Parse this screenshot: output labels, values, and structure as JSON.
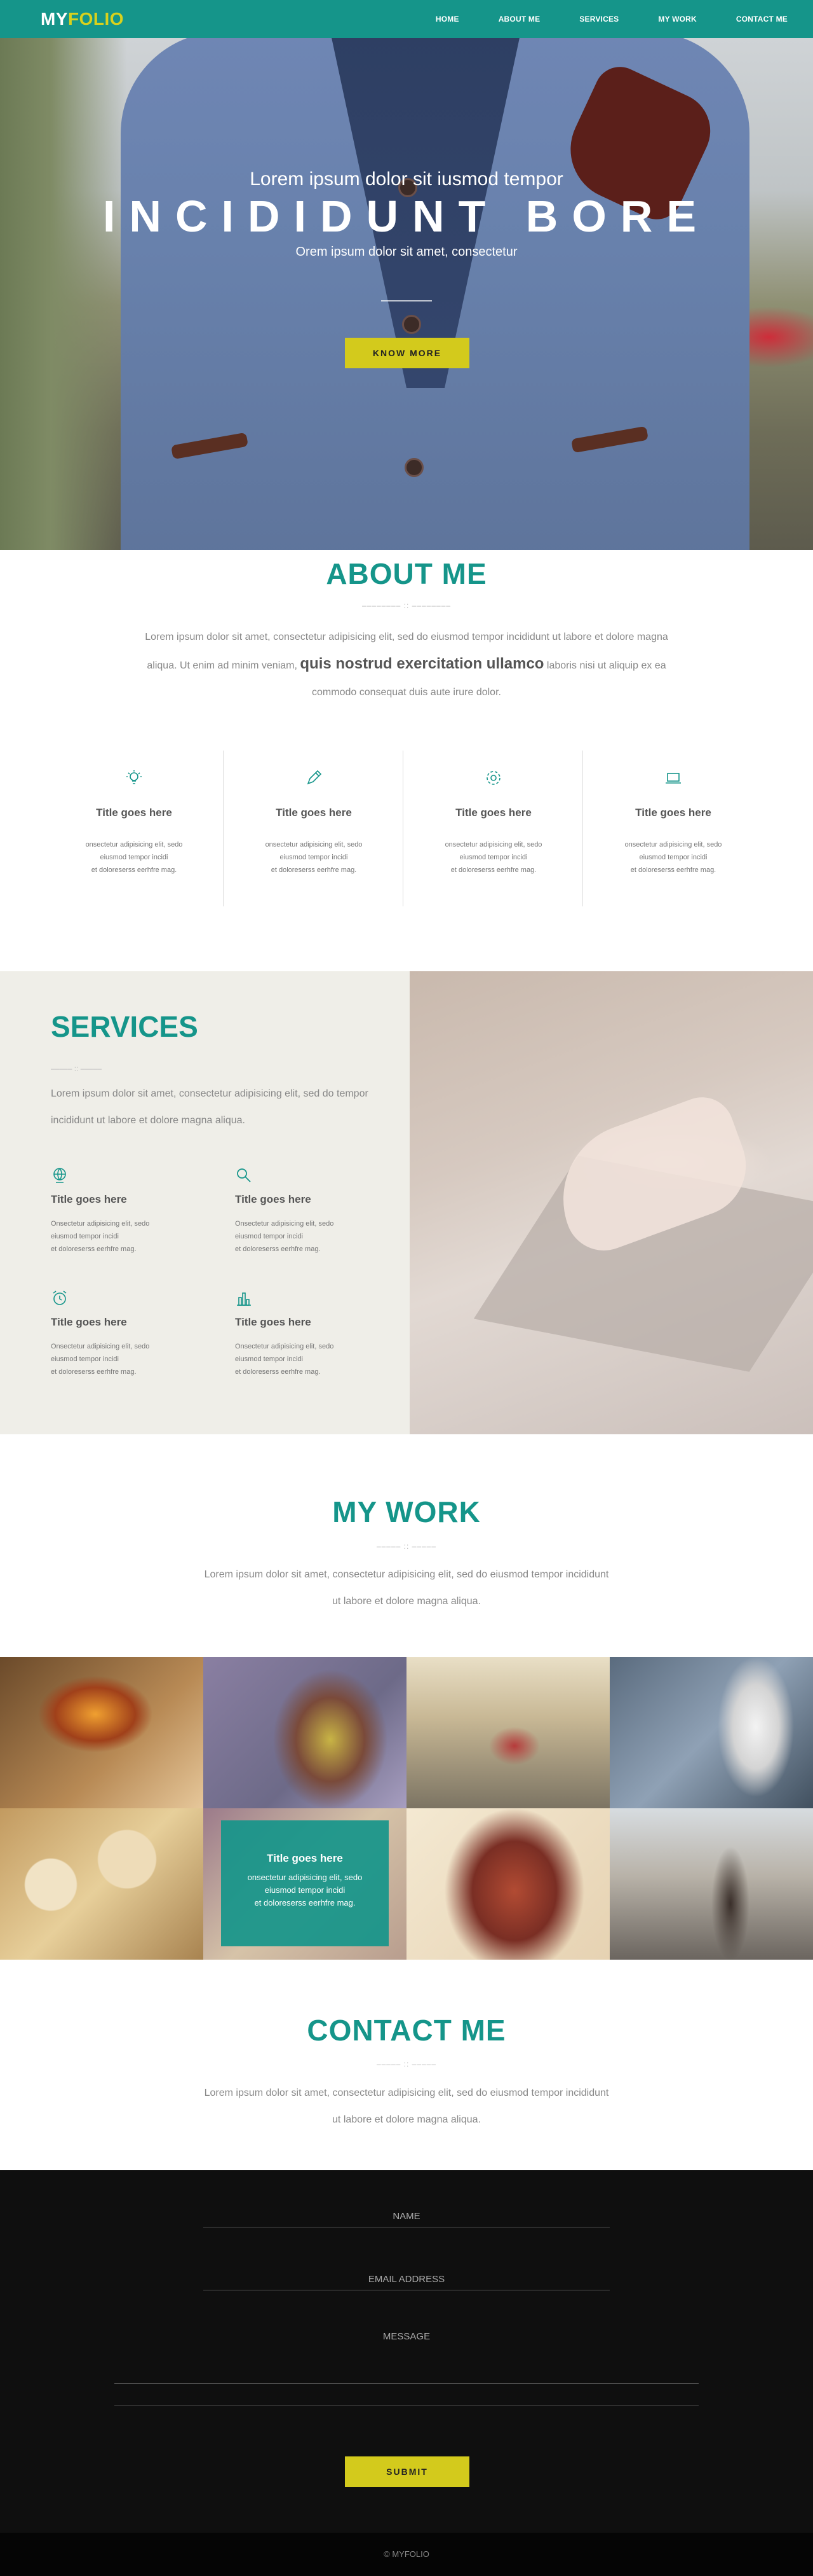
{
  "nav": {
    "logo_white": "MY",
    "logo_yellow": "FOLIO",
    "items": [
      "HOME",
      "ABOUT ME",
      "SERVICES",
      "MY WORK",
      "CONTACT ME"
    ]
  },
  "hero": {
    "subtitle": "Lorem ipsum dolor sit iusmod tempor",
    "title": "INCIDIDUNT BORE",
    "small": "Orem ipsum dolor sit amet, consectetur",
    "button": "KNOW MORE"
  },
  "about": {
    "title": "ABOUT ME",
    "deco": "–––––––– :: ––––––––",
    "para_1": "Lorem ipsum dolor sit amet, consectetur adipisicing elit, sed do eiusmod tempor incididunt ut labore et dolore magna",
    "para_2a": "aliqua. Ut enim ad minim veniam,",
    "para_2b": "quis nostrud exercitation ullamco",
    "para_2c": "laboris nisi ut aliquip ex ea",
    "para_3": "commodo consequat duis aute irure dolor.",
    "features": [
      {
        "icon": "lightbulb-icon",
        "title": "Title goes here",
        "d1": "onsectetur adipisicing elit, sedo",
        "d2": "eiusmod tempor incidi",
        "d3": "et doloreserss eerhfre mag."
      },
      {
        "icon": "pencil-icon",
        "title": "Title goes here",
        "d1": "onsectetur adipisicing elit, sedo",
        "d2": "eiusmod tempor incidi",
        "d3": "et doloreserss eerhfre mag."
      },
      {
        "icon": "gear-icon",
        "title": "Title goes here",
        "d1": "onsectetur adipisicing elit, sedo",
        "d2": "eiusmod tempor incidi",
        "d3": "et doloreserss eerhfre mag."
      },
      {
        "icon": "laptop-icon",
        "title": "Title goes here",
        "d1": "onsectetur adipisicing elit, sedo",
        "d2": "eiusmod tempor incidi",
        "d3": "et doloreserss eerhfre mag."
      }
    ]
  },
  "services": {
    "title": "SERVICES",
    "deco": "––––– :: –––––",
    "para": "Lorem ipsum dolor sit amet, consectetur adipisicing elit, sed do tempor incididunt ut labore et dolore magna aliqua.",
    "items": [
      {
        "icon": "globe-icon",
        "title": "Title goes here",
        "d1": "Onsectetur adipisicing elit, sedo",
        "d2": "eiusmod tempor incidi",
        "d3": "et doloreserss eerhfre mag."
      },
      {
        "icon": "search-icon",
        "title": "Title goes here",
        "d1": "Onsectetur adipisicing elit, sedo",
        "d2": "eiusmod tempor incidi",
        "d3": "et doloreserss eerhfre mag."
      },
      {
        "icon": "alarm-clock-icon",
        "title": "Title goes here",
        "d1": "Onsectetur adipisicing elit, sedo",
        "d2": "eiusmod tempor incidi",
        "d3": "et doloreserss eerhfre mag."
      },
      {
        "icon": "bar-chart-icon",
        "title": "Title goes here",
        "d1": "Onsectetur adipisicing elit, sedo",
        "d2": "eiusmod tempor incidi",
        "d3": "et doloreserss eerhfre mag."
      }
    ]
  },
  "work": {
    "title": "MY WORK",
    "deco": "––––– :: –––––",
    "para_1": "Lorem ipsum dolor sit amet, consectetur adipisicing elit, sed do eiusmod tempor incididunt",
    "para_2": "ut labore et dolore magna aliqua.",
    "overlay": {
      "title": "Title goes here",
      "d1": "onsectetur adipisicing elit, sedo",
      "d2": "eiusmod tempor incidi",
      "d3": "et doloreserss eerhfre mag."
    }
  },
  "contact": {
    "title": "CONTACT ME",
    "deco": "––––– :: –––––",
    "para_1": "Lorem ipsum dolor sit amet, consectetur adipisicing elit, sed do eiusmod tempor incididunt",
    "para_2": "ut labore et dolore magna aliqua.",
    "name_placeholder": "NAME",
    "email_placeholder": "EMAIL ADDRESS",
    "message_placeholder": "MESSAGE",
    "submit": "SUBMIT"
  },
  "footer": {
    "text": "© MYFOLIO"
  },
  "colors": {
    "accent": "#15958a",
    "yellow": "#d3ca1c"
  }
}
